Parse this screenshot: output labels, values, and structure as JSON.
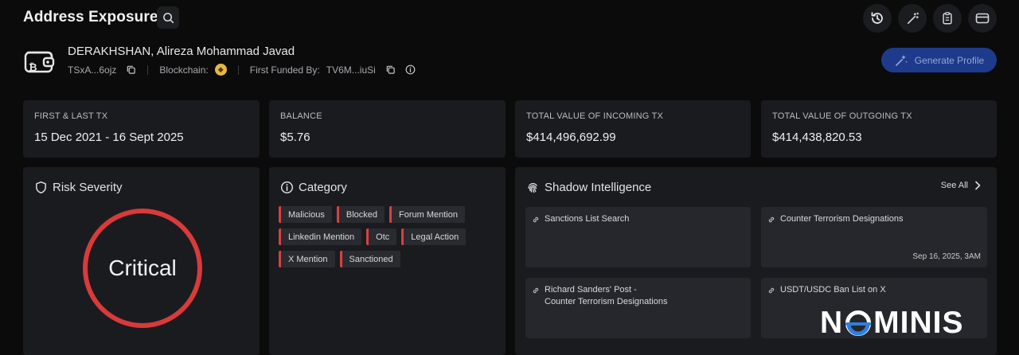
{
  "header": {
    "title": "Address Exposure",
    "icons": [
      "search-icon",
      "history-icon",
      "magic-wand-icon",
      "clipboard-icon",
      "wallet-card-icon"
    ]
  },
  "entity": {
    "name": "DERAKHSHAN, Alireza Mohammad Javad",
    "address": "TSxA...6ojz",
    "blockchain_label": "Blockchain:",
    "blockchain_coin": "tron-coin-icon",
    "first_funded_label": "First Funded By:",
    "first_funded_value": "TV6M...iuSi"
  },
  "actions": {
    "generate_profile": "Generate Profile"
  },
  "stats": [
    {
      "label": "FIRST & LAST TX",
      "value": "15 Dec 2021 - 16 Sept 2025"
    },
    {
      "label": "BALANCE",
      "value": "$5.76"
    },
    {
      "label": "TOTAL VALUE OF INCOMING TX",
      "value": "$414,496,692.99"
    },
    {
      "label": "TOTAL VALUE OF OUTGOING TX",
      "value": "$414,438,820.53"
    }
  ],
  "risk": {
    "title": "Risk Severity",
    "level": "Critical"
  },
  "category": {
    "title": "Category",
    "tags": [
      "Malicious",
      "Blocked",
      "Forum Mention",
      "Linkedin Mention",
      "Otc",
      "Legal Action",
      "X Mention",
      "Sanctioned"
    ]
  },
  "intel": {
    "title": "Shadow Intelligence",
    "see_all": "See All",
    "cards": [
      {
        "line1": "Sanctions List Search",
        "line2": "",
        "date": ""
      },
      {
        "line1": "Counter Terrorism Designations",
        "line2": "",
        "date": "Sep 16, 2025, 3AM"
      },
      {
        "line1": "Richard Sanders' Post -",
        "line2": "Counter Terrorism Designations",
        "date": ""
      },
      {
        "line1": "USDT/USDC Ban List on X",
        "line2": "",
        "date": ""
      }
    ]
  },
  "branding": {
    "logo_text_left": "N",
    "logo_text_right": "MINIS",
    "accent": "#1e3a8a",
    "danger": "#d93a3a",
    "coin": "#e8b64a"
  }
}
